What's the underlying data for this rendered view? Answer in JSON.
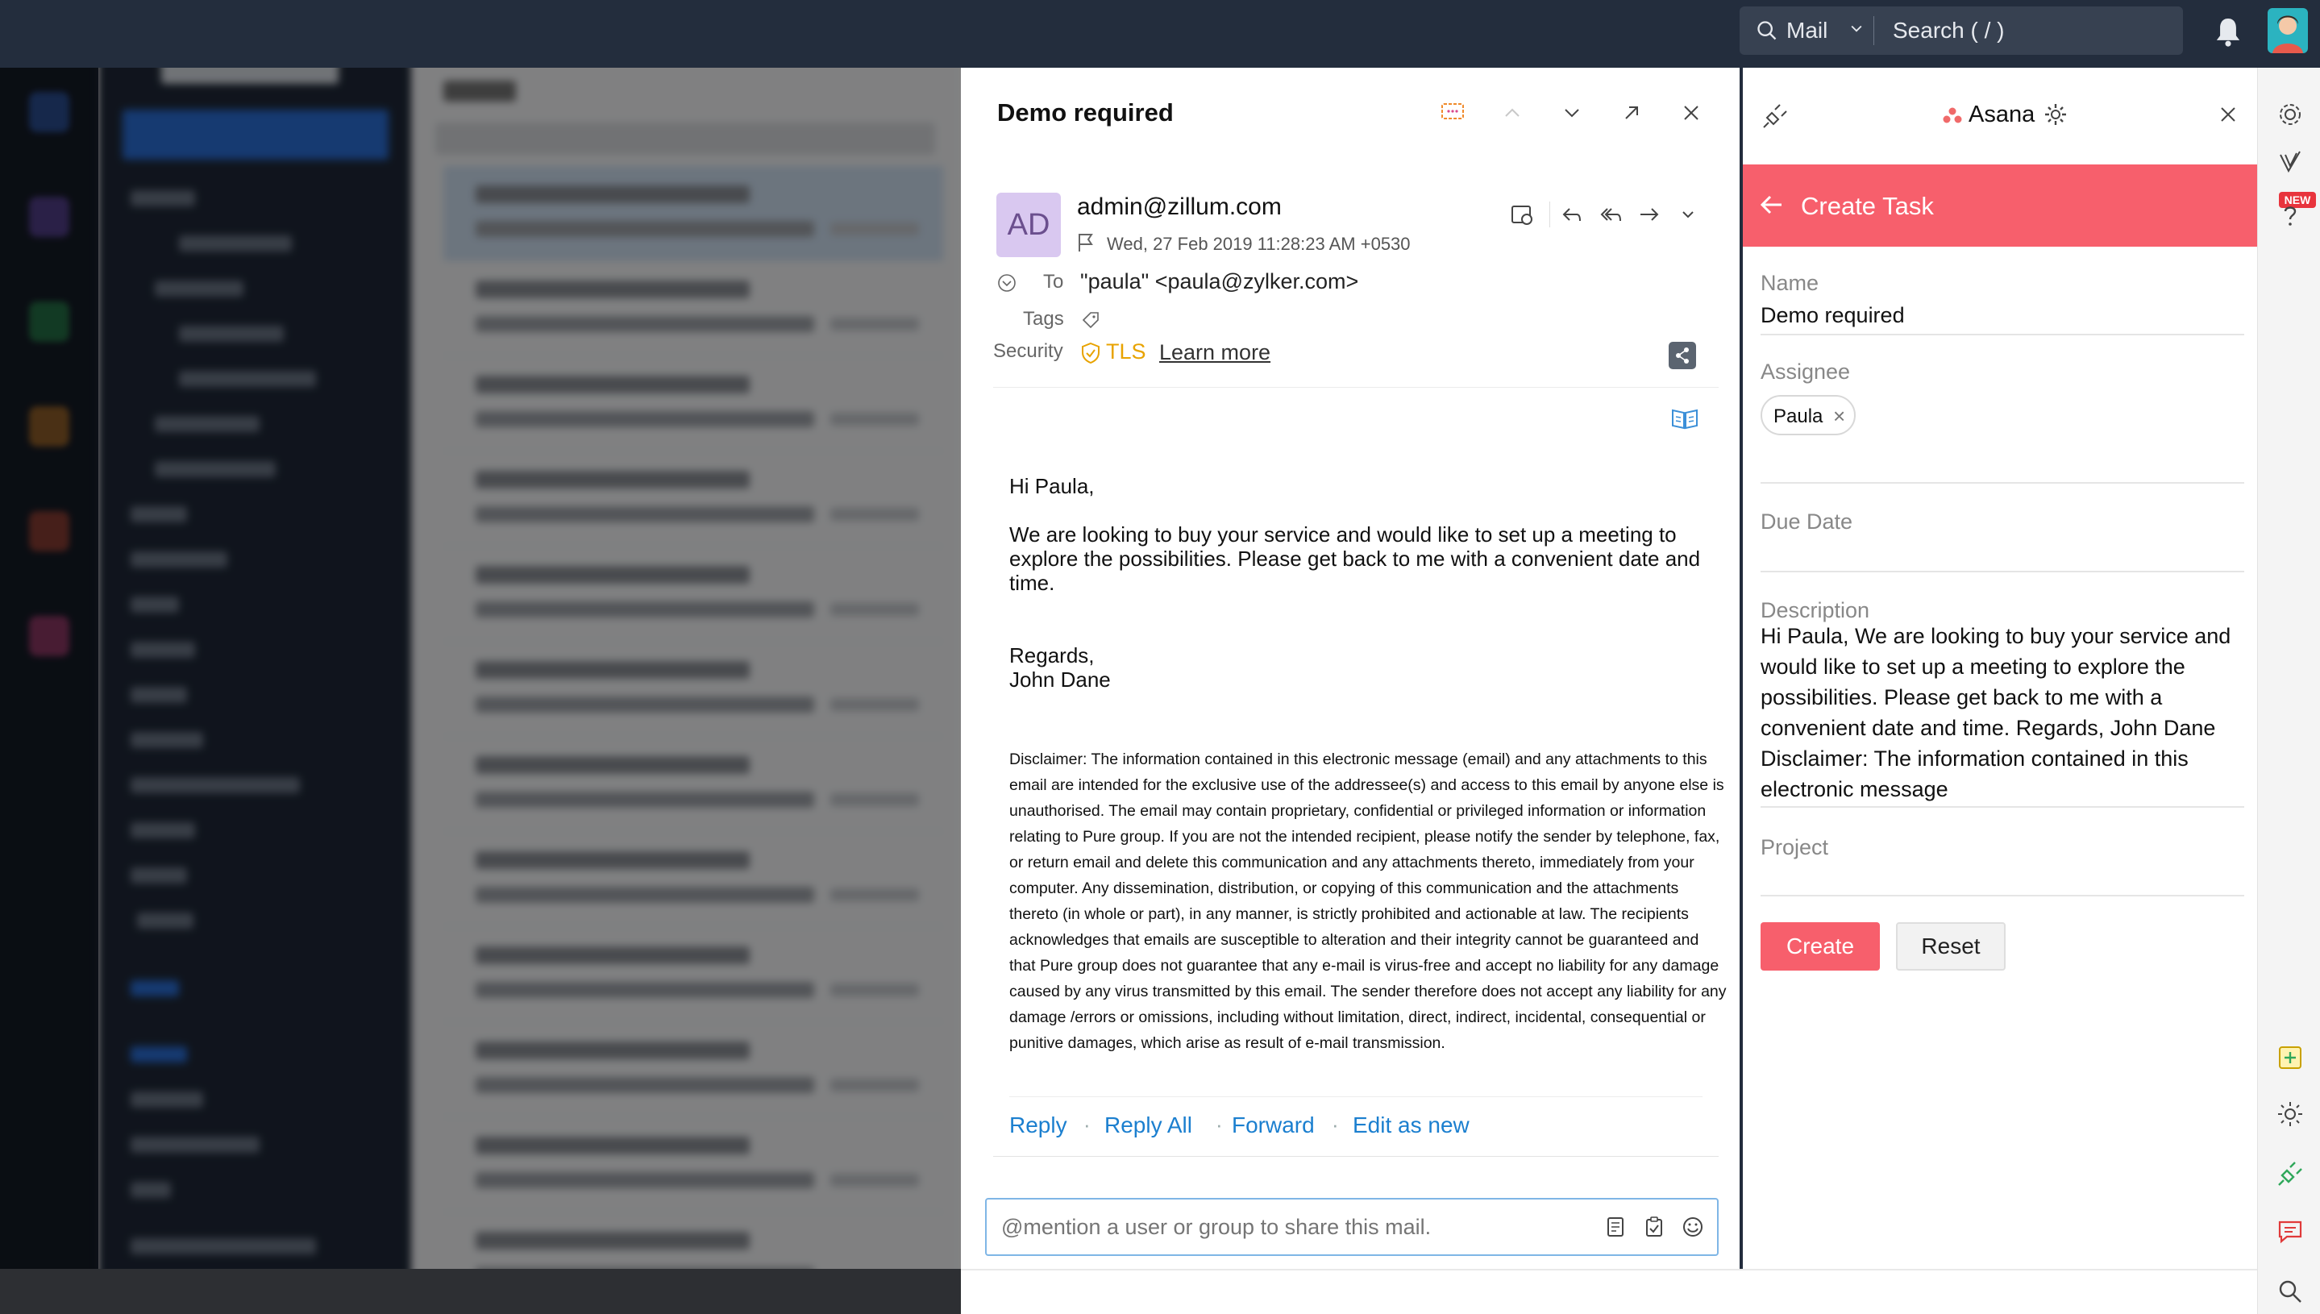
{
  "topbar": {
    "search_scope": "Mail",
    "search_placeholder": "Search ( / )"
  },
  "mail": {
    "subject": "Demo required",
    "sender_initials": "AD",
    "sender_email": "admin@zillum.com",
    "date": "Wed, 27 Feb 2019 11:28:23 AM +0530",
    "to_label": "To",
    "to_value": "\"paula\" <paula@zylker.com>",
    "tags_label": "Tags",
    "security_label": "Security",
    "tls": "TLS",
    "learn_more": "Learn more",
    "greeting": "Hi Paula,",
    "body": "We are looking to buy your service and would like to set up a meeting to explore the possibilities. Please get back to me with a convenient date and time.",
    "regards": "Regards,",
    "signature": "John Dane",
    "disclaimer": "Disclaimer: The information contained in this electronic message (email) and any attachments to this email are intended for the exclusive use of the addressee(s) and access to this email by anyone else is unauthorised. The email may contain proprietary, confidential or privileged information or information relating to Pure group. If you are not the intended recipient, please notify the sender by telephone, fax, or return email and delete this communication and any attachments thereto, immediately from your computer. Any dissemination, distribution, or copying of this communication and the attachments thereto (in whole or part), in any manner, is strictly prohibited and actionable at law. The recipients acknowledges that emails are susceptible to alteration and their integrity cannot be guaranteed and that Pure group  does not guarantee that any e-mail is virus-free and accept no liability for any damage caused by any virus transmitted by this email. The sender therefore does not accept any liability for any damage /errors or omissions, including without limitation, direct, indirect, incidental, consequential or punitive damages, which arise as result of e-mail transmission.",
    "actions": {
      "reply": "Reply",
      "reply_all": "Reply All",
      "forward": "Forward",
      "edit_as_new": "Edit as new"
    },
    "mention_placeholder": "@mention a user or group to share this mail."
  },
  "asana": {
    "title": "Asana",
    "header": "Create Task",
    "name_label": "Name",
    "name_value": "Demo required",
    "assignee_label": "Assignee",
    "assignee_chip": "Paula",
    "due_date_label": "Due Date",
    "description_label": "Description",
    "description_value": "Hi Paula, We are looking to buy your service and would like to set up a meeting to explore the possibilities. Please get back to me with a convenient date and time. Regards, John Dane Disclaimer: The information contained in this electronic message",
    "project_label": "Project",
    "create_label": "Create",
    "reset_label": "Reset"
  },
  "right_rail": {
    "new_badge": "NEW"
  },
  "colors": {
    "topbar": "#232d3d",
    "asana_accent": "#f75f6c",
    "link": "#1b7fcf",
    "tls": "#e8a300"
  }
}
